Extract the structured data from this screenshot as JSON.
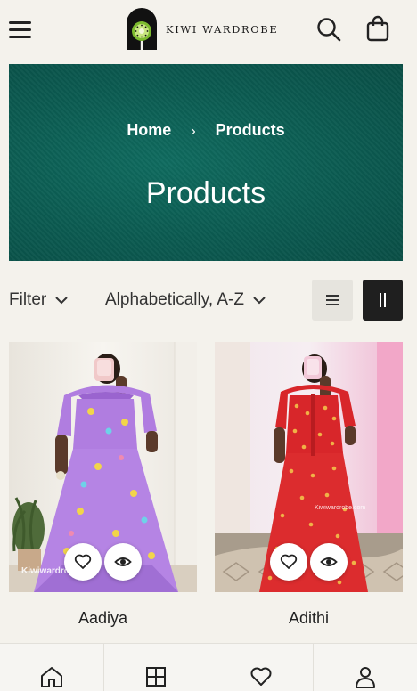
{
  "header": {
    "brand": "KIWI WARDROBE",
    "icons": {
      "menu": "hamburger-menu-icon",
      "search": "search-icon",
      "cart": "shopping-bag-icon"
    }
  },
  "hero": {
    "breadcrumb": [
      {
        "label": "Home"
      },
      {
        "label": "Products"
      }
    ],
    "separator": "›",
    "title": "Products",
    "color": "#0b5b51"
  },
  "toolbar": {
    "filter_label": "Filter",
    "sort_label": "Alphabetically, A-Z",
    "view_modes": [
      "list",
      "grid"
    ],
    "active_view": "grid"
  },
  "products": [
    {
      "name": "Aadiya",
      "watermark": "Kiwiwardro",
      "dress_color": "#b07de0"
    },
    {
      "name": "Adithi",
      "watermark": "Kiwiwardrobe.com",
      "dress_color": "#d8262a"
    }
  ],
  "bottom_nav": [
    {
      "icon": "home-icon"
    },
    {
      "icon": "grid-icon"
    },
    {
      "icon": "heart-icon"
    },
    {
      "icon": "user-icon"
    }
  ],
  "colors": {
    "background": "#f4f2ec",
    "accent": "#1f1f1f",
    "hero": "#0b5b51"
  }
}
